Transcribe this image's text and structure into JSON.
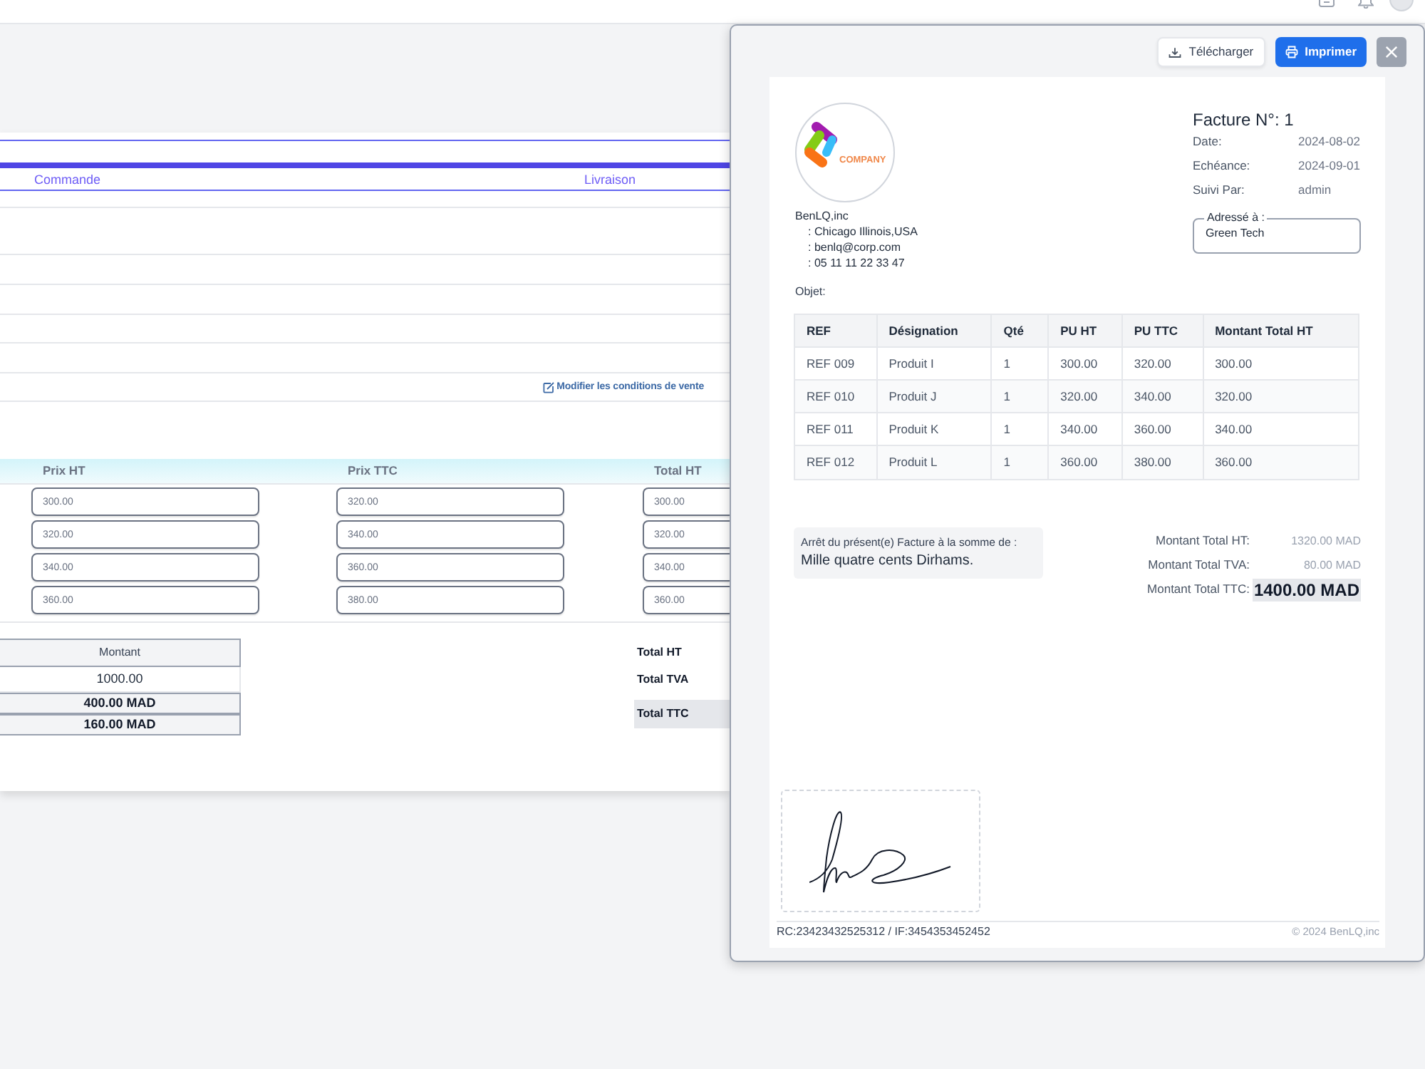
{
  "order_form": {
    "header_columns": [
      "Commande",
      "Livraison"
    ],
    "conditions_link": "Modifier les conditions de vente",
    "lines": {
      "columns": [
        "Prix HT",
        "Prix TTC",
        "Total HT"
      ],
      "rows": [
        [
          "300.00",
          "320.00",
          "300.00"
        ],
        [
          "320.00",
          "340.00",
          "320.00"
        ],
        [
          "340.00",
          "360.00",
          "340.00"
        ],
        [
          "360.00",
          "380.00",
          "360.00"
        ]
      ]
    },
    "amount_table": {
      "column": "Montant",
      "rows": [
        {
          "value": "1000.00",
          "kind": "value"
        },
        {
          "value": "400.00 MAD",
          "kind": "total"
        },
        {
          "value": "160.00 MAD",
          "kind": "total"
        }
      ]
    },
    "totals": [
      {
        "label": "Total HT",
        "highlighted": false
      },
      {
        "label": "Total TVA",
        "highlighted": false
      },
      {
        "label": "Total TTC",
        "highlighted": true
      }
    ]
  },
  "invoice_preview": {
    "buttons": [
      {
        "kind": "download",
        "label": "Télécharger"
      },
      {
        "kind": "print",
        "label": "Imprimer"
      },
      {
        "kind": "close"
      }
    ],
    "logo_text": "COMPANY",
    "company": {
      "name": "BenLQ,inc",
      "details": [
        ": Chicago Illinois,USA",
        ": benlq@corp.com",
        ": 05 11 11 22 33 47"
      ]
    },
    "title": "Facture N°: 1",
    "meta": [
      {
        "label": "Date:",
        "value": "2024-08-02"
      },
      {
        "label": "Echéance:",
        "value": "2024-09-01"
      },
      {
        "label": "Suivi Par:",
        "value": "admin"
      }
    ],
    "addressee": {
      "legend": "Adressé à :",
      "name": "Green Tech"
    },
    "subject_label": "Objet:",
    "table": {
      "columns": [
        "REF",
        "Désignation",
        "Qté",
        "PU HT",
        "PU TTC",
        "Montant Total HT"
      ],
      "rows": [
        [
          "REF 009",
          "Produit I",
          "1",
          "300.00",
          "320.00",
          "300.00"
        ],
        [
          "REF 010",
          "Produit J",
          "1",
          "320.00",
          "340.00",
          "320.00"
        ],
        [
          "REF 011",
          "Produit K",
          "1",
          "340.00",
          "360.00",
          "340.00"
        ],
        [
          "REF 012",
          "Produit L",
          "1",
          "360.00",
          "380.00",
          "360.00"
        ]
      ]
    },
    "amount_in_words": {
      "label": "Arrêt du présent(e) Facture à la somme de :",
      "value": "Mille quatre cents Dirhams."
    },
    "totals": [
      {
        "label": "Montant Total HT:",
        "value": "1320.00 MAD",
        "highlighted": false
      },
      {
        "label": "Montant Total TVA:",
        "value": "80.00 MAD",
        "highlighted": false
      },
      {
        "label": "Montant Total TTC:",
        "value": "1400.00 MAD",
        "highlighted": true
      }
    ],
    "footer": {
      "registration": "RC:23423432525312 / IF:3454353452452",
      "copyright": "© 2024 BenLQ,inc"
    }
  }
}
